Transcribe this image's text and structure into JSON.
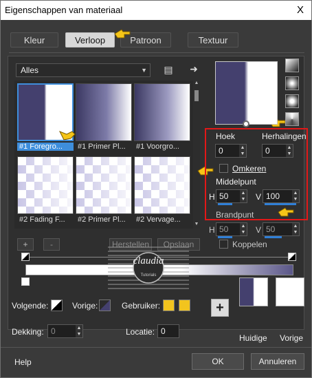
{
  "window": {
    "title": "Eigenschappen van materiaal",
    "close": "X"
  },
  "tabs": [
    "Kleur",
    "Verloop",
    "Patroon",
    "Textuur"
  ],
  "active_tab": "Verloop",
  "category": {
    "value": "Alles"
  },
  "gradients": [
    {
      "label": "#1 Foregro..."
    },
    {
      "label": "#1 Primer Pl..."
    },
    {
      "label": "#1 Voorgro..."
    },
    {
      "label": "#2 Fading F..."
    },
    {
      "label": "#2 Primer Pl..."
    },
    {
      "label": "#2 Vervage..."
    }
  ],
  "settings": {
    "angle_label": "Hoek",
    "angle_value": "0",
    "repeats_label": "Herhalingen",
    "repeats_value": "0",
    "invert_label": "Omkeren",
    "centerpoint_label": "Middelpunt",
    "h_label": "H",
    "h_value": "50",
    "v_label": "V",
    "v_value": "100",
    "focal_label": "Brandpunt",
    "fh_value": "50",
    "fv_value": "50",
    "link_label": "Koppelen"
  },
  "editor": {
    "add": "+",
    "remove": "-",
    "restore": "Herstellen",
    "save": "Opslaan"
  },
  "watermark": {
    "name": "claudia",
    "sub": "Tutorials"
  },
  "stops": {
    "next_label": "Volgende:",
    "prev_label": "Vorige:",
    "user_label": "Gebruiker:",
    "opacity_label": "Dekking:",
    "opacity_value": "0",
    "location_label": "Locatie:",
    "location_value": "0",
    "user_color": "#f2c41e"
  },
  "preview_labels": {
    "current": "Huidige",
    "previous": "Vorige"
  },
  "footer": {
    "help": "Help",
    "ok": "OK",
    "cancel": "Annuleren"
  },
  "colors": {
    "primary": "#44406e",
    "secondary": "#ffffff",
    "accent": "#2f7fd7",
    "highlight_box": "#e21818"
  }
}
